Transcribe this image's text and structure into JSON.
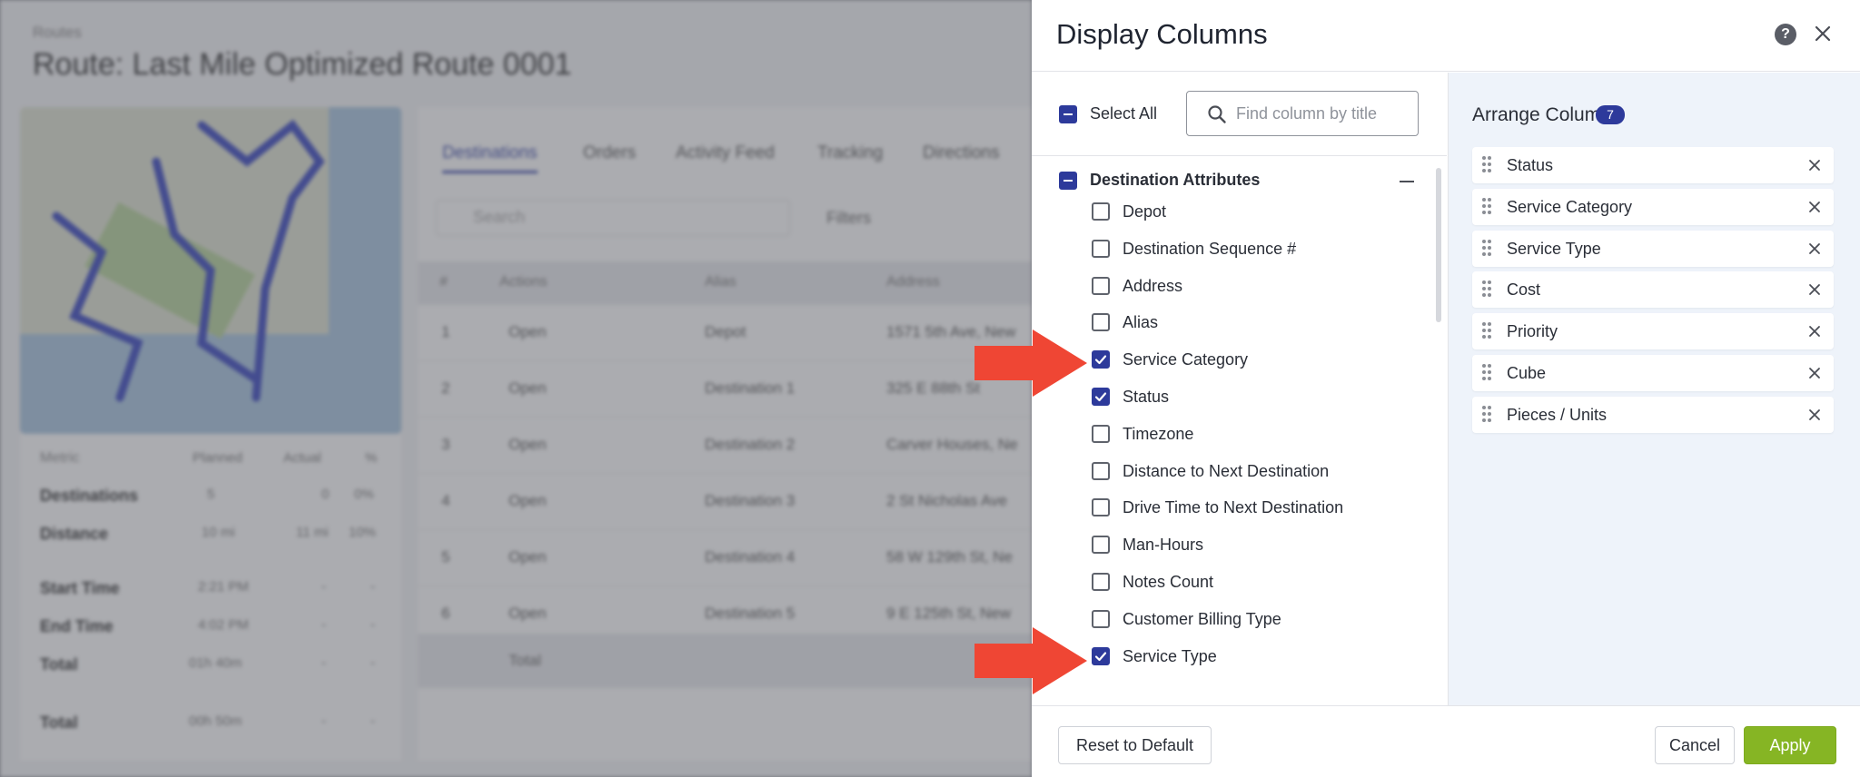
{
  "background": {
    "breadcrumb": "Routes",
    "title": "Route: Last Mile Optimized Route 0001",
    "tabs": [
      "Destinations",
      "Orders",
      "Activity Feed",
      "Tracking",
      "Directions"
    ],
    "search_placeholder": "Search",
    "filters_label": "Filters",
    "table_headers": [
      "#",
      "Actions",
      "Alias",
      "Address"
    ],
    "rows": [
      {
        "num": "1",
        "action": "Open",
        "alias": "Depot",
        "address": "1571 5th Ave, New"
      },
      {
        "num": "2",
        "action": "Open",
        "alias": "Destination 1",
        "address": "325 E 88th St"
      },
      {
        "num": "3",
        "action": "Open",
        "alias": "Destination 2",
        "address": "Carver Houses, Ne"
      },
      {
        "num": "4",
        "action": "Open",
        "alias": "Destination 3",
        "address": "2 St Nicholas Ave"
      },
      {
        "num": "5",
        "action": "Open",
        "alias": "Destination 4",
        "address": "58 W 129th St, Ne"
      },
      {
        "num": "6",
        "action": "Open",
        "alias": "Destination 5",
        "address": "9 E 125th St, New"
      }
    ],
    "total_label": "Total",
    "stats_headers": [
      "Metric",
      "Planned",
      "Actual",
      "%"
    ],
    "stats": [
      {
        "label": "Destinations",
        "planned": "5",
        "actual": "0",
        "pct": "0%"
      },
      {
        "label": "Distance",
        "planned": "10 mi",
        "actual": "11 mi",
        "pct": "10%"
      },
      {
        "label": "Start Time",
        "planned": "2:21 PM",
        "actual": "-",
        "pct": "-"
      },
      {
        "label": "End Time",
        "planned": "4:02 PM",
        "actual": "-",
        "pct": "-"
      },
      {
        "label": "Total",
        "planned": "01h 40m",
        "actual": "-",
        "pct": "-"
      },
      {
        "label": "Total",
        "planned": "00h 50m",
        "actual": "-",
        "pct": "-"
      }
    ]
  },
  "drawer": {
    "title": "Display Columns",
    "help_icon_glyph": "?",
    "select_all_label": "Select All",
    "search_placeholder": "Find column by title",
    "group": {
      "label": "Destination Attributes",
      "items": [
        {
          "label": "Depot",
          "checked": false
        },
        {
          "label": "Destination Sequence #",
          "checked": false
        },
        {
          "label": "Address",
          "checked": false
        },
        {
          "label": "Alias",
          "checked": false
        },
        {
          "label": "Service Category",
          "checked": true
        },
        {
          "label": "Status",
          "checked": true
        },
        {
          "label": "Timezone",
          "checked": false
        },
        {
          "label": "Distance to Next Destination",
          "checked": false
        },
        {
          "label": "Drive Time to Next Destination",
          "checked": false
        },
        {
          "label": "Man-Hours",
          "checked": false
        },
        {
          "label": "Notes Count",
          "checked": false
        },
        {
          "label": "Customer Billing Type",
          "checked": false
        },
        {
          "label": "Service Type",
          "checked": true
        }
      ]
    },
    "arrange": {
      "title": "Arrange Columns",
      "count": "7",
      "columns": [
        "Status",
        "Service Category",
        "Service Type",
        "Cost",
        "Priority",
        "Cube",
        "Pieces / Units"
      ]
    },
    "footer": {
      "reset_label": "Reset to Default",
      "cancel_label": "Cancel",
      "apply_label": "Apply"
    }
  },
  "colors": {
    "accent": "#2d3a9b",
    "apply_green": "#86b524",
    "arrow_red": "#ef4634",
    "arrange_bg": "#eef3fa"
  }
}
